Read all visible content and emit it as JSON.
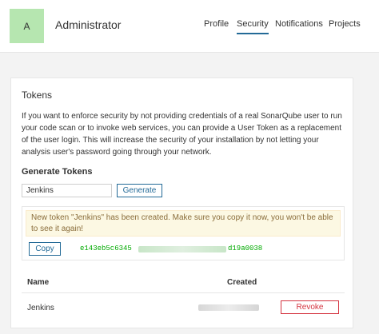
{
  "header": {
    "avatar_letter": "A",
    "username": "Administrator",
    "nav": [
      {
        "label": "Profile",
        "active": false
      },
      {
        "label": "Security",
        "active": true
      },
      {
        "label": "Notifications",
        "active": false
      },
      {
        "label": "Projects",
        "active": false
      }
    ]
  },
  "tokens": {
    "title": "Tokens",
    "description": "If you want to enforce security by not providing credentials of a real SonarQube user to run your code scan or to invoke web services, you can provide a User Token as a replacement of the user login. This will increase the security of your installation by not letting your analysis user's password going through your network.",
    "generate": {
      "title": "Generate Tokens",
      "input_value": "Jenkins",
      "button_label": "Generate"
    },
    "new_token": {
      "message": "New token \"Jenkins\" has been created. Make sure you copy it now, you won't be able to see it again!",
      "copy_label": "Copy",
      "token_start": "e143eb5c6345",
      "token_end": "d19a0038"
    },
    "table": {
      "headers": [
        "Name",
        "Created"
      ],
      "rows": [
        {
          "name": "Jenkins",
          "revoke_label": "Revoke"
        }
      ]
    }
  },
  "colors": {
    "accent": "#236a97",
    "danger": "#d4333f",
    "avatar_bg": "#b6e6b0",
    "token_text": "#00aa00",
    "alert_bg": "#fcf8e3"
  }
}
